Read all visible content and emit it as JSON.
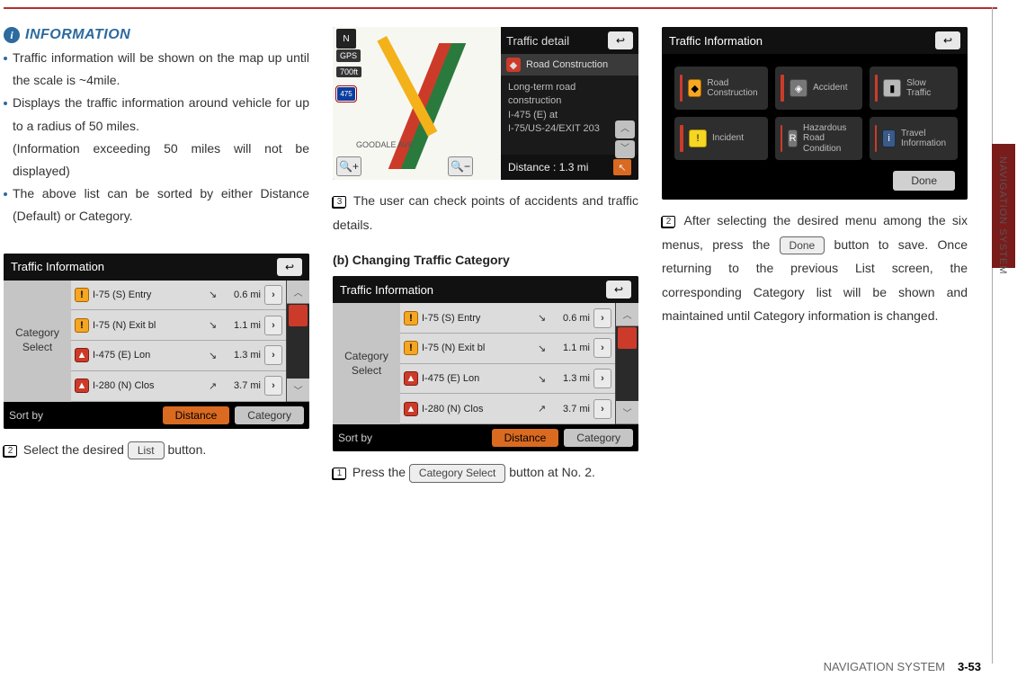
{
  "info": {
    "heading": "INFORMATION",
    "bullets": [
      "Traffic information will be shown on the map up until the scale is ~4mile.",
      "Displays the traffic information around vehicle for up to a radius of 50 miles.",
      "The above list can be sorted by either Distance (Default) or Category."
    ],
    "bullet2_note": "(Information exceeding 50 miles will not be displayed)"
  },
  "listScreen": {
    "title": "Traffic Information",
    "categorySelect": "Category Select",
    "rows": [
      {
        "icon": "!",
        "name": "I-75 (S) Entry",
        "dir": "↘",
        "dist": "0.6 mi"
      },
      {
        "icon": "!",
        "name": "I-75 (N) Exit bl",
        "dir": "↘",
        "dist": "1.1 mi"
      },
      {
        "icon": "▲",
        "name": "I-475 (E) Lon",
        "dir": "↘",
        "dist": "1.3 mi"
      },
      {
        "icon": "▲",
        "name": "I-280 (N) Clos",
        "dir": "↗",
        "dist": "3.7 mi"
      }
    ],
    "sortLabel": "Sort by",
    "sortDistance": "Distance",
    "sortCategory": "Category"
  },
  "col1": {
    "step2_pre": "Select the desired ",
    "step2_btn": "List",
    "step2_post": " button."
  },
  "mapShot": {
    "gps": "GPS",
    "scale": "700ft",
    "shield": "475",
    "street": "GOODALE AVE",
    "detailTitle": "Traffic detail",
    "rcLabel": "Road Construction",
    "body1": "Long-term road construction",
    "body2": "I-475 (E)  at",
    "body3": "I-75/US-24/EXIT 203",
    "footer": "Distance : 1.3 mi"
  },
  "col2": {
    "step3": "The user can check points of accidents and traffic details.",
    "sectionB": "(b) Changing Traffic Category",
    "step1_pre": "Press the ",
    "step1_btn": "Category Select",
    "step1_post": " button at No. 2."
  },
  "catScreen": {
    "title": "Traffic Information",
    "items": [
      {
        "label": "Road Construction",
        "ico": "orange",
        "glyph": "◆"
      },
      {
        "label": "Accident",
        "ico": "gray",
        "glyph": "◈"
      },
      {
        "label": "Slow Traffic",
        "ico": "slow",
        "glyph": "▮"
      },
      {
        "label": "Incident",
        "ico": "yellow",
        "glyph": "!"
      },
      {
        "label": "Hazardous Road Condition",
        "ico": "gray",
        "glyph": "R"
      },
      {
        "label": "Travel Information",
        "ico": "blue",
        "glyph": "i"
      }
    ],
    "done": "Done"
  },
  "col3": {
    "step2a": "After selecting the desired menu among the six menus, press the ",
    "step2btn": "Done",
    "step2b": " button to save. Once returning to the previous List screen, the corresponding Category list will be shown and maintained until Category information is changed."
  },
  "sideTab": "NAVIGATION SYSTEM",
  "footer": {
    "label": "NAVIGATION SYSTEM",
    "page": "3-53"
  }
}
